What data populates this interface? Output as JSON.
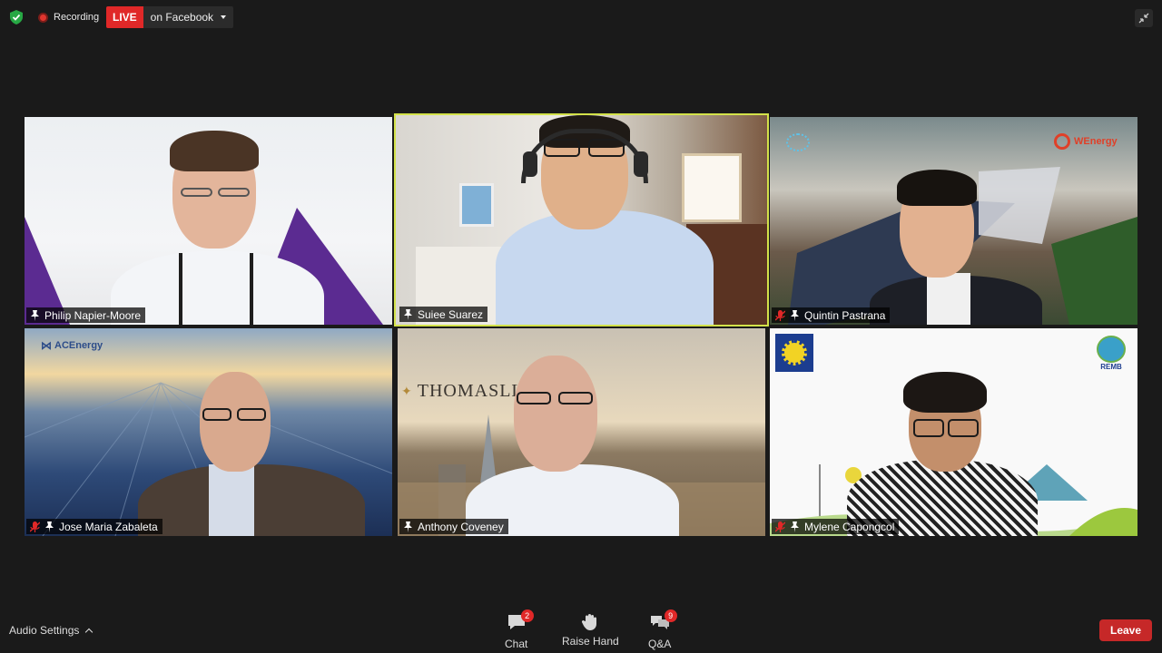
{
  "top_bar": {
    "recording_label": "Recording",
    "live_label": "LIVE",
    "stream_target": "on Facebook",
    "security_icon": "shield-check-icon",
    "exit_fullscreen_icon": "exit-fullscreen-icon"
  },
  "participants": [
    {
      "name": "Philip Napier-Moore",
      "muted": false,
      "active_speaker": false,
      "logo_text": ""
    },
    {
      "name": "Suiee Suarez",
      "muted": false,
      "active_speaker": true,
      "logo_text": ""
    },
    {
      "name": "Quintin Pastrana",
      "muted": true,
      "active_speaker": false,
      "logo_text": "WEnergy"
    },
    {
      "name": "Jose Maria Zabaleta",
      "muted": true,
      "active_speaker": false,
      "logo_text": "ACEnergy"
    },
    {
      "name": "Anthony Coveney",
      "muted": false,
      "active_speaker": false,
      "logo_text": "THOMASLL"
    },
    {
      "name": "Mylene Capongcol",
      "muted": true,
      "active_speaker": false,
      "logo_text": "REMB"
    }
  ],
  "toolbar": {
    "audio_settings_label": "Audio Settings",
    "chat_label": "Chat",
    "chat_badge": "2",
    "raise_hand_label": "Raise Hand",
    "qa_label": "Q&A",
    "qa_badge": "9",
    "leave_label": "Leave"
  },
  "colors": {
    "background": "#1a1a1a",
    "active_speaker_border": "#d3e24a",
    "live_red": "#e02828",
    "leave_red": "#c62828"
  }
}
